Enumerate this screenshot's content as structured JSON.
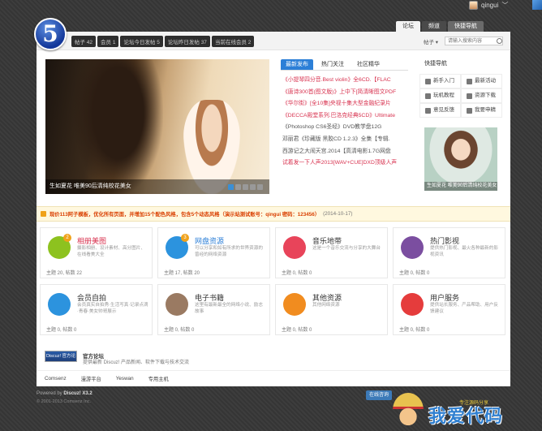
{
  "user": {
    "name": "qingui"
  },
  "logo": {
    "text": "5"
  },
  "stats": [
    "帖子 42",
    "会员 1",
    "论坛今日发帖 5",
    "论坛昨日发帖 37",
    "当前在线会员 2"
  ],
  "tabs": [
    "论坛",
    "频道",
    "快捷导航"
  ],
  "search": {
    "type": "帖子",
    "placeholder": "请输入搜索内容"
  },
  "slideshow": {
    "caption": "生如夏花 唯美90后清纯校花美女"
  },
  "news": {
    "tabs": [
      "最新发布",
      "热门关注",
      "社区精华"
    ],
    "items": [
      "《小提琴四分音.Best violin》全6CD.【FLAC",
      "《唐诗300首(图文版)》上中下[简清晰图文PDF",
      "《华尔街》[全10集]央视十集大型金融纪录片",
      "《DECCA殿堂系列.巴洛克经典5CD》Ultimate",
      "《Photoshop CS6圣经》DVD教学盘12G",
      "邓丽君《珍藏版 黑胶CD 1.2.3》全集【专辑.",
      "西游记之大闹天宫.2014【高清电影1.7G网盘",
      "试着发一下人声2013[WAV+CUE]DXD顶级人声"
    ]
  },
  "quicknav": {
    "title": "快捷导航",
    "items": [
      "新手入门",
      "最新活动",
      "玩机教程",
      "资源下载",
      "意见反馈",
      "我要申精"
    ],
    "image_caption": "生如夏花 唯美90后清纯校花美女"
  },
  "notice": {
    "text": "现价113阿子模板，优化所有页面，并增加15个配色风格，包含5个动态风格（演示站测试账号：qingui  密码：123456）",
    "date": "(2014-10-17)"
  },
  "forums": [
    {
      "name": "相册美图",
      "desc": "摄影相册、设计素材、高分图片、在线看美大全",
      "count": "主题 20, 帖数 22",
      "color": "#8dc21f",
      "badge": "2",
      "icon": "photo-icon"
    },
    {
      "name": "网盘资源",
      "desc": "可以分享和如有所求的世界资源的曾经的网络资源",
      "count": "主题 17, 帖数 20",
      "color": "#2c93de",
      "badge": "3",
      "icon": "cloud-disk-icon"
    },
    {
      "name": "音乐地带",
      "desc": "这是一个音乐交流与分享的大舞台",
      "count": "主题 0, 帖数 0",
      "color": "#e8445a",
      "badge": "",
      "icon": "music-note-icon"
    },
    {
      "name": "热门影视",
      "desc": "提供热门影视、最火各种最新的影视资讯",
      "count": "主题 0, 帖数 0",
      "color": "#7b4ea0",
      "badge": "",
      "icon": "film-reel-icon"
    },
    {
      "name": "会员自拍",
      "desc": "会员真实自拍秀·生活写真·记录点滴·青春·美女帅哥展示",
      "count": "主题 0, 帖数 0",
      "color": "#2c93de",
      "badge": "",
      "icon": "portrait-icon"
    },
    {
      "name": "电子书籍",
      "desc": "这里有最新最全的网络小说、励志故事",
      "count": "主题 0, 帖数 0",
      "color": "#9a7a62",
      "badge": "",
      "icon": "book-icon"
    },
    {
      "name": "其他资源",
      "desc": "其他网络资源",
      "count": "主题 0, 帖数 0",
      "color": "#f18c1f",
      "badge": "",
      "icon": "crown-icon"
    },
    {
      "name": "用户服务",
      "desc": "提供站长服务、产品帮助、用户反馈建议",
      "count": "主题 0, 帖数 0",
      "color": "#e53c3c",
      "badge": "",
      "icon": "vip-icon"
    }
  ],
  "official": {
    "logo": "Discuz! 官方论坛",
    "name": "官方论坛",
    "desc": "提供最新 Discuz! 产品新闻、软件下载与技术交流"
  },
  "links": [
    "Comsenz",
    "漫游平台",
    "Yeswan",
    "专用主机"
  ],
  "footer": {
    "powered": "Powered by ",
    "brand": "Discuz! X3.2",
    "copyright": "© 2001-2013 Comsenz Inc.",
    "online": "在线咨询"
  },
  "watermark": {
    "brand": "我爱代码",
    "sub": "专注源码分享"
  }
}
